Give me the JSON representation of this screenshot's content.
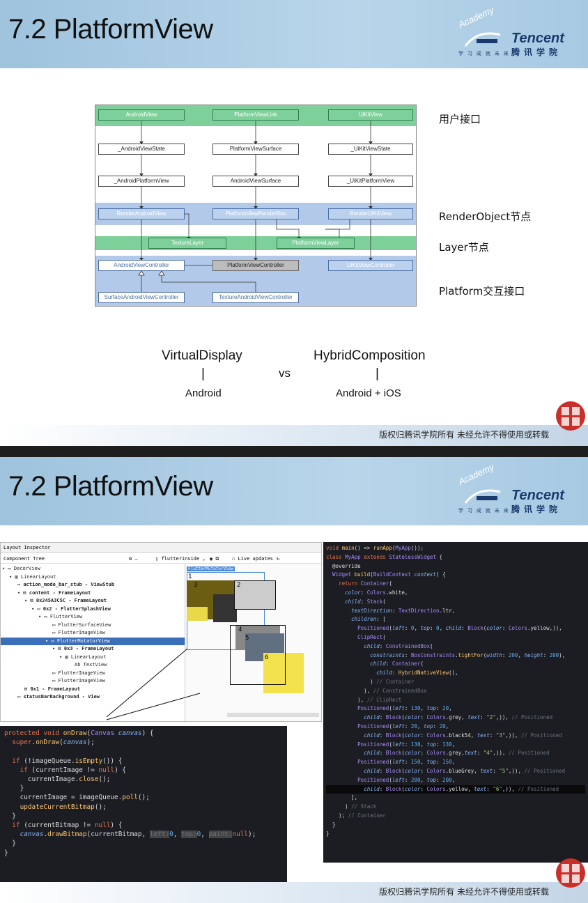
{
  "slide1": {
    "title": "7.2 PlatformView",
    "logo": {
      "academy": "Academy",
      "brand": "Tencent",
      "cn": "腾讯学院",
      "small": "学 习 成 就 未 来"
    },
    "diagram": {
      "row1": [
        "AndroidView",
        "PlatformViewLink",
        "UiKitView"
      ],
      "row2": [
        "_AndroidViewState",
        "PlatformViewSurface",
        "_UiKitViewState"
      ],
      "row3": [
        "_AndroidPlatformView",
        "AndroidViewSurface",
        "_UiKitPlatformView"
      ],
      "row4": [
        "RenderAndroidView",
        "PlatformViewRenderBox",
        "RenderUiKitView"
      ],
      "row5": [
        "TextureLayer",
        "PlatformViewLayer"
      ],
      "row6": [
        "AndroidViewController",
        "PlatformViewController",
        "UiKitViewController"
      ],
      "row7": [
        "SurfaceAndroidViewController",
        "TextureAndroidViewController"
      ],
      "colors": {
        "green": "#7ed09a",
        "blue": "#b3c9ea"
      }
    },
    "labels": [
      "用户接口",
      "RenderObject节点",
      "Layer节点",
      "Platform交互接口"
    ],
    "compare": {
      "left_title": "VirtualDisplay",
      "left_bar": "|",
      "left_sub": "Android",
      "vs": "vs",
      "right_title": "HybridComposition",
      "right_bar": "|",
      "right_sub": "Android + iOS"
    },
    "footer": "版权归腾讯学院所有 未经允许不得使用或转载"
  },
  "slide2": {
    "title": "7.2 PlatformView",
    "inspector": {
      "title": "Layout Inspector",
      "component_tree": "Component Tree",
      "device": "flutterinside",
      "live_updates": "Live updates",
      "mutator_label": "FlutterMutatorView",
      "tree": [
        "DecorView",
        "LinearLayout",
        "action_mode_bar_stub - ViewStub",
        "content - FrameLayout",
        "0x245A3C5C - FrameLayout",
        "0x2 - FlutterSplashView",
        "FlutterView",
        "FlutterSurfaceView",
        "FlutterImageView",
        "FlutterMutatorView",
        "0x3 - FrameLayout",
        "LinearLayout",
        "TextView",
        "FlutterImageView",
        "FlutterImageView",
        "0x1 - FrameLayout",
        "statusBarBackground - View"
      ],
      "boxes": [
        "1",
        "2",
        "3",
        "4",
        "5",
        "6"
      ]
    },
    "footer": "版权归腾讯学院所有 未经允许不得使用或转载"
  }
}
